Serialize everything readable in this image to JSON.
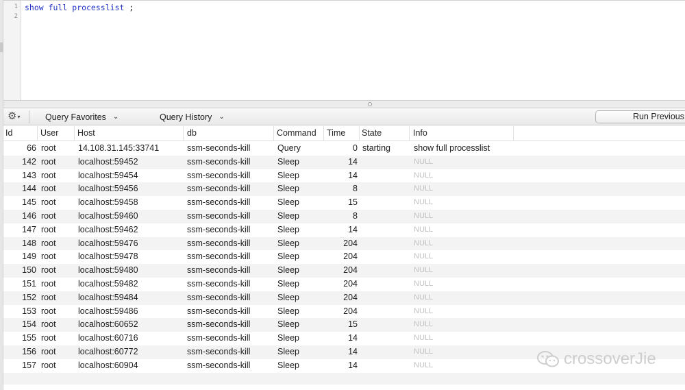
{
  "editor": {
    "lines": [
      {
        "number": "1",
        "keyword": "show full processlist",
        "rest": " ;"
      },
      {
        "number": "2",
        "keyword": "",
        "rest": ""
      }
    ]
  },
  "toolbar": {
    "gear_icon": "gear-icon",
    "favorites_label": "Query Favorites",
    "history_label": "Query History",
    "run_label": "Run Previous"
  },
  "grid": {
    "columns": [
      "Id",
      "User",
      "Host",
      "db",
      "Command",
      "Time",
      "State",
      "Info"
    ],
    "rows": [
      {
        "id": "66",
        "user": "root",
        "host": "14.108.31.145:33741",
        "db": "ssm-seconds-kill",
        "command": "Query",
        "time": "0",
        "state": "starting",
        "info": "show full processlist"
      },
      {
        "id": "142",
        "user": "root",
        "host": "localhost:59452",
        "db": "ssm-seconds-kill",
        "command": "Sleep",
        "time": "14",
        "state": "",
        "info": "NULL"
      },
      {
        "id": "143",
        "user": "root",
        "host": "localhost:59454",
        "db": "ssm-seconds-kill",
        "command": "Sleep",
        "time": "14",
        "state": "",
        "info": "NULL"
      },
      {
        "id": "144",
        "user": "root",
        "host": "localhost:59456",
        "db": "ssm-seconds-kill",
        "command": "Sleep",
        "time": "8",
        "state": "",
        "info": "NULL"
      },
      {
        "id": "145",
        "user": "root",
        "host": "localhost:59458",
        "db": "ssm-seconds-kill",
        "command": "Sleep",
        "time": "15",
        "state": "",
        "info": "NULL"
      },
      {
        "id": "146",
        "user": "root",
        "host": "localhost:59460",
        "db": "ssm-seconds-kill",
        "command": "Sleep",
        "time": "8",
        "state": "",
        "info": "NULL"
      },
      {
        "id": "147",
        "user": "root",
        "host": "localhost:59462",
        "db": "ssm-seconds-kill",
        "command": "Sleep",
        "time": "14",
        "state": "",
        "info": "NULL"
      },
      {
        "id": "148",
        "user": "root",
        "host": "localhost:59476",
        "db": "ssm-seconds-kill",
        "command": "Sleep",
        "time": "204",
        "state": "",
        "info": "NULL"
      },
      {
        "id": "149",
        "user": "root",
        "host": "localhost:59478",
        "db": "ssm-seconds-kill",
        "command": "Sleep",
        "time": "204",
        "state": "",
        "info": "NULL"
      },
      {
        "id": "150",
        "user": "root",
        "host": "localhost:59480",
        "db": "ssm-seconds-kill",
        "command": "Sleep",
        "time": "204",
        "state": "",
        "info": "NULL"
      },
      {
        "id": "151",
        "user": "root",
        "host": "localhost:59482",
        "db": "ssm-seconds-kill",
        "command": "Sleep",
        "time": "204",
        "state": "",
        "info": "NULL"
      },
      {
        "id": "152",
        "user": "root",
        "host": "localhost:59484",
        "db": "ssm-seconds-kill",
        "command": "Sleep",
        "time": "204",
        "state": "",
        "info": "NULL"
      },
      {
        "id": "153",
        "user": "root",
        "host": "localhost:59486",
        "db": "ssm-seconds-kill",
        "command": "Sleep",
        "time": "204",
        "state": "",
        "info": "NULL"
      },
      {
        "id": "154",
        "user": "root",
        "host": "localhost:60652",
        "db": "ssm-seconds-kill",
        "command": "Sleep",
        "time": "15",
        "state": "",
        "info": "NULL"
      },
      {
        "id": "155",
        "user": "root",
        "host": "localhost:60716",
        "db": "ssm-seconds-kill",
        "command": "Sleep",
        "time": "14",
        "state": "",
        "info": "NULL"
      },
      {
        "id": "156",
        "user": "root",
        "host": "localhost:60772",
        "db": "ssm-seconds-kill",
        "command": "Sleep",
        "time": "14",
        "state": "",
        "info": "NULL"
      },
      {
        "id": "157",
        "user": "root",
        "host": "localhost:60904",
        "db": "ssm-seconds-kill",
        "command": "Sleep",
        "time": "14",
        "state": "",
        "info": "NULL"
      }
    ]
  },
  "watermark": {
    "icon": "wechat-icon",
    "text": "crossoverJie"
  },
  "colors": {
    "keyword": "#2233c4",
    "null_text": "#c2c2c2",
    "row_alt": "#f3f3f3"
  }
}
